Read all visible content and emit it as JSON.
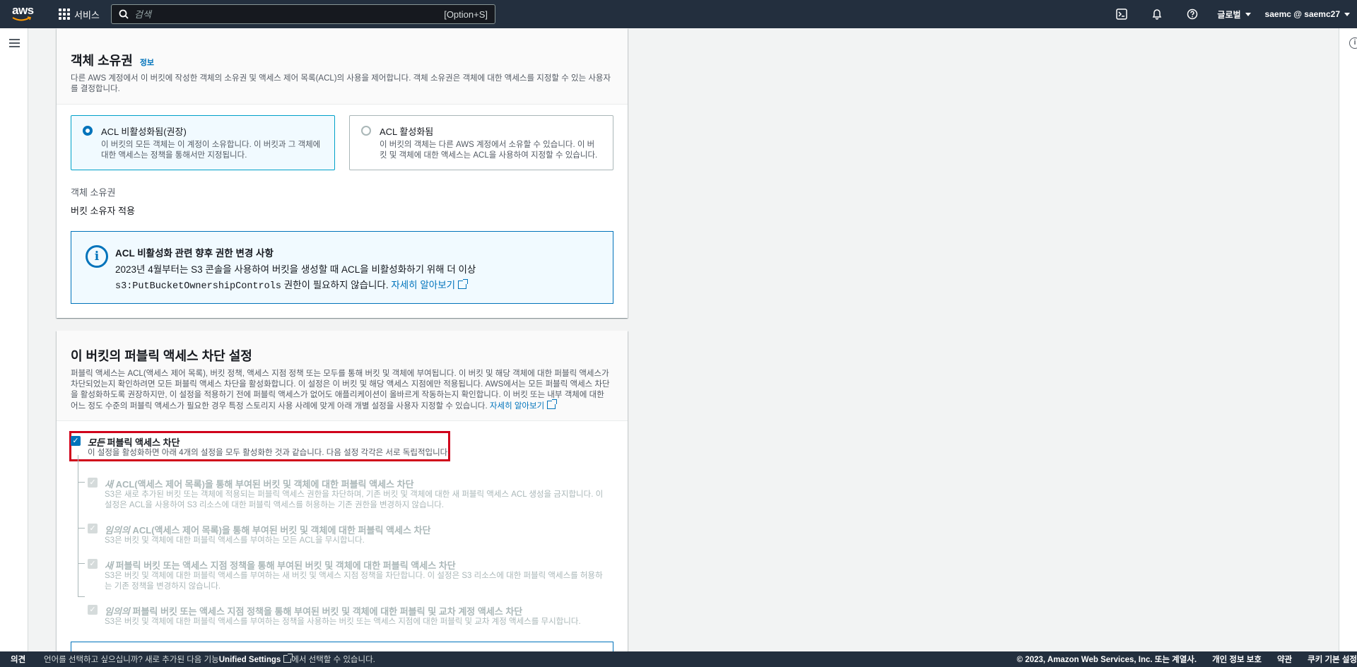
{
  "nav": {
    "logo_text": "aws",
    "services_label": "서비스",
    "search_placeholder": "검색",
    "search_shortcut": "[Option+S]",
    "region_label": "글로벌",
    "account_label": "saemc @ saemc27"
  },
  "ownership": {
    "title": "객체 소유권",
    "info_label": "정보",
    "description": "다른 AWS 계정에서 이 버킷에 작성한 객체의 소유권 및 액세스 제어 목록(ACL)의 사용을 제어합니다. 객체 소유권은 객체에 대한 액세스를 지정할 수 있는 사용자를 결정합니다.",
    "options": [
      {
        "title": "ACL 비활성화됨(권장)",
        "desc": "이 버킷의 모든 객체는 이 계정이 소유합니다. 이 버킷과 그 객체에 대한 액세스는 정책을 통해서만 지정됩니다.",
        "selected": true
      },
      {
        "title": "ACL 활성화됨",
        "desc": "이 버킷의 객체는 다른 AWS 계정에서 소유할 수 있습니다. 이 버킷 및 객체에 대한 액세스는 ACL을 사용하여 지정할 수 있습니다.",
        "selected": false
      }
    ],
    "field_label": "객체 소유권",
    "field_value": "버킷 소유자 적용",
    "alert": {
      "title": "ACL 비활성화 관련 향후 권한 변경 사항",
      "body_prefix": "2023년 4월부터는 S3 콘솔을 사용하여 버킷을 생성할 때 ACL을 비활성화하기 위해 더 이상",
      "code": "s3:PutBucketOwnershipControls",
      "body_suffix": " 권한이 필요하지 않습니다.",
      "link": "자세히 알아보기"
    }
  },
  "public_access": {
    "title": "이 버킷의 퍼블릭 액세스 차단 설정",
    "description": "퍼블릭 액세스는 ACL(액세스 제어 목록), 버킷 정책, 액세스 지점 정책 또는 모두를 통해 버킷 및 객체에 부여됩니다. 이 버킷 및 해당 객체에 대한 퍼블릭 액세스가 차단되었는지 확인하려면 모든 퍼블릭 액세스 차단을 활성화합니다. 이 설정은 이 버킷 및 해당 액세스 지점에만 적용됩니다. AWS에서는 모든 퍼블릭 액세스 차단을 활성화하도록 권장하지만, 이 설정을 적용하기 전에 퍼블릭 액세스가 없어도 애플리케이션이 올바르게 작동하는지 확인합니다. 이 버킷 또는 내부 객체에 대한 어느 정도 수준의 퍼블릭 액세스가 필요한 경우 특정 스토리지 사용 사례에 맞게 아래 개별 설정을 사용자 지정할 수 있습니다.",
    "learn_more": "자세히 알아보기",
    "block_all": {
      "title_em": "모든",
      "title_rest": " 퍼블릭 액세스 차단",
      "desc": "이 설정을 활성화하면 아래 4개의 설정을 모두 활성화한 것과 같습니다. 다음 설정 각각은 서로 독립적입니다."
    },
    "sub_options": [
      {
        "title_em": "새",
        "title_rest": " ACL(액세스 제어 목록)을 통해 부여된 버킷 및 객체에 대한 퍼블릭 액세스 차단",
        "desc": "S3은 새로 추가된 버킷 또는 객체에 적용되는 퍼블릭 액세스 권한을 차단하며, 기존 버킷 및 객체에 대한 새 퍼블릭 액세스 ACL 생성을 금지합니다. 이 설정은 ACL을 사용하여 S3 리소스에 대한 퍼블릭 액세스를 허용하는 기존 권한을 변경하지 않습니다."
      },
      {
        "title_em": "임의의",
        "title_rest": " ACL(액세스 제어 목록)을 통해 부여된 버킷 및 객체에 대한 퍼블릭 액세스 차단",
        "desc": "S3은 버킷 및 객체에 대한 퍼블릭 액세스를 부여하는 모든 ACL을 무시합니다."
      },
      {
        "title_em": "새",
        "title_rest": " 퍼블릭 버킷 또는 액세스 지점 정책을 통해 부여된 버킷 및 객체에 대한 퍼블릭 액세스 차단",
        "desc": "S3은 버킷 및 객체에 대한 퍼블릭 액세스를 부여하는 새 버킷 및 액세스 지점 정책을 차단합니다. 이 설정은 S3 리소스에 대한 퍼블릭 액세스를 허용하는 기존 정책을 변경하지 않습니다."
      },
      {
        "title_em": "임의의",
        "title_rest": " 퍼블릭 버킷 또는 액세스 지점 정책을 통해 부여된 버킷 및 객체에 대한 퍼블릭 및 교차 계정 액세스 차단",
        "desc": "S3은 버킷 및 객체에 대한 퍼블릭 액세스를 부여하는 정책을 사용하는 버킷 또는 액세스 지점에 대한 퍼블릭 및 교차 계정 액세스를 무시합니다."
      }
    ]
  },
  "footer": {
    "feedback": "의견",
    "lang_prefix": "언어를 선택하고 싶으십니까? 새로 추가된 다음 기능",
    "lang_link": "Unified Settings",
    "lang_suffix": "에서 선택할 수 있습니다.",
    "copyright": "© 2023, Amazon Web Services, Inc. 또는 계열사.",
    "privacy": "개인 정보 보호",
    "terms": "약관",
    "cookies": "쿠키 기본 설정"
  }
}
